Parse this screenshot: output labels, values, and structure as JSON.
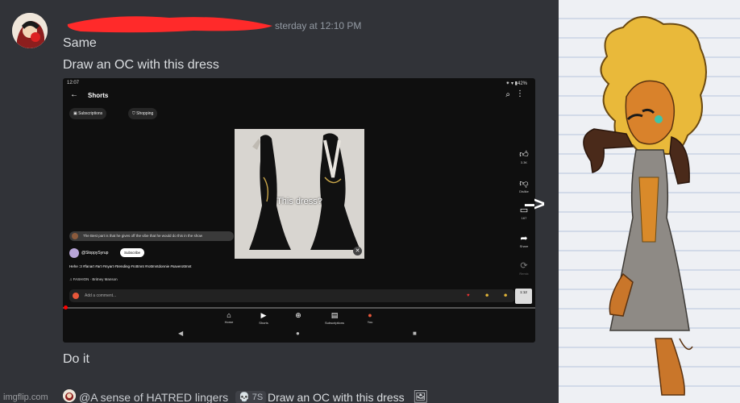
{
  "message": {
    "timestamp": "sterday at 12:10 PM",
    "lines": [
      "Same",
      "Draw an OC with this dress"
    ],
    "reply": "Do it"
  },
  "screenshot": {
    "status_time": "12:07",
    "status_icons": "⁕ ▾ ▮42%",
    "header_title": "Shorts",
    "chips": [
      "Subscriptions",
      "Shopping"
    ],
    "video_caption": "This dress?",
    "rail": [
      {
        "icon": "thumbs-up-icon",
        "label": "3.3K"
      },
      {
        "icon": "thumbs-down-icon",
        "label": "Dislike"
      },
      {
        "icon": "comment-icon",
        "label": "167"
      },
      {
        "icon": "share-icon",
        "label": "Share"
      },
      {
        "icon": "remix-icon",
        "label": "Remix"
      }
    ],
    "top_comment": "The Best part is that he gives off the vibe that he would do this in the show",
    "channel": "@SloppySyrup",
    "subscribe_label": "Subscribe",
    "description": "Hehe :3 #fanart #art #myart #trending #rottmnt #rottmntdonnie #saverottmnt",
    "music": "FASHION · Britney Manson",
    "add_comment_placeholder": "Add a comment...",
    "mini_thumb_label": "1:12",
    "nav": [
      {
        "icon": "home-icon",
        "label": "Home"
      },
      {
        "icon": "shorts-icon",
        "label": "Shorts"
      },
      {
        "icon": "create-icon",
        "label": ""
      },
      {
        "icon": "subscriptions-icon",
        "label": "Subscriptions"
      },
      {
        "icon": "you-icon",
        "label": "You"
      }
    ]
  },
  "footer": {
    "watermark": "imgflip.com",
    "username": "@A sense of HATRED lingers",
    "badge": "💀 7S",
    "text": "Draw an OC with this dress"
  },
  "arrow_text": "-->",
  "colors": {
    "discord_bg": "#313338",
    "text": "#dbdee1",
    "muted": "#949ba4",
    "redaction": "#ff2a2a",
    "yt_red": "#ff0000"
  }
}
